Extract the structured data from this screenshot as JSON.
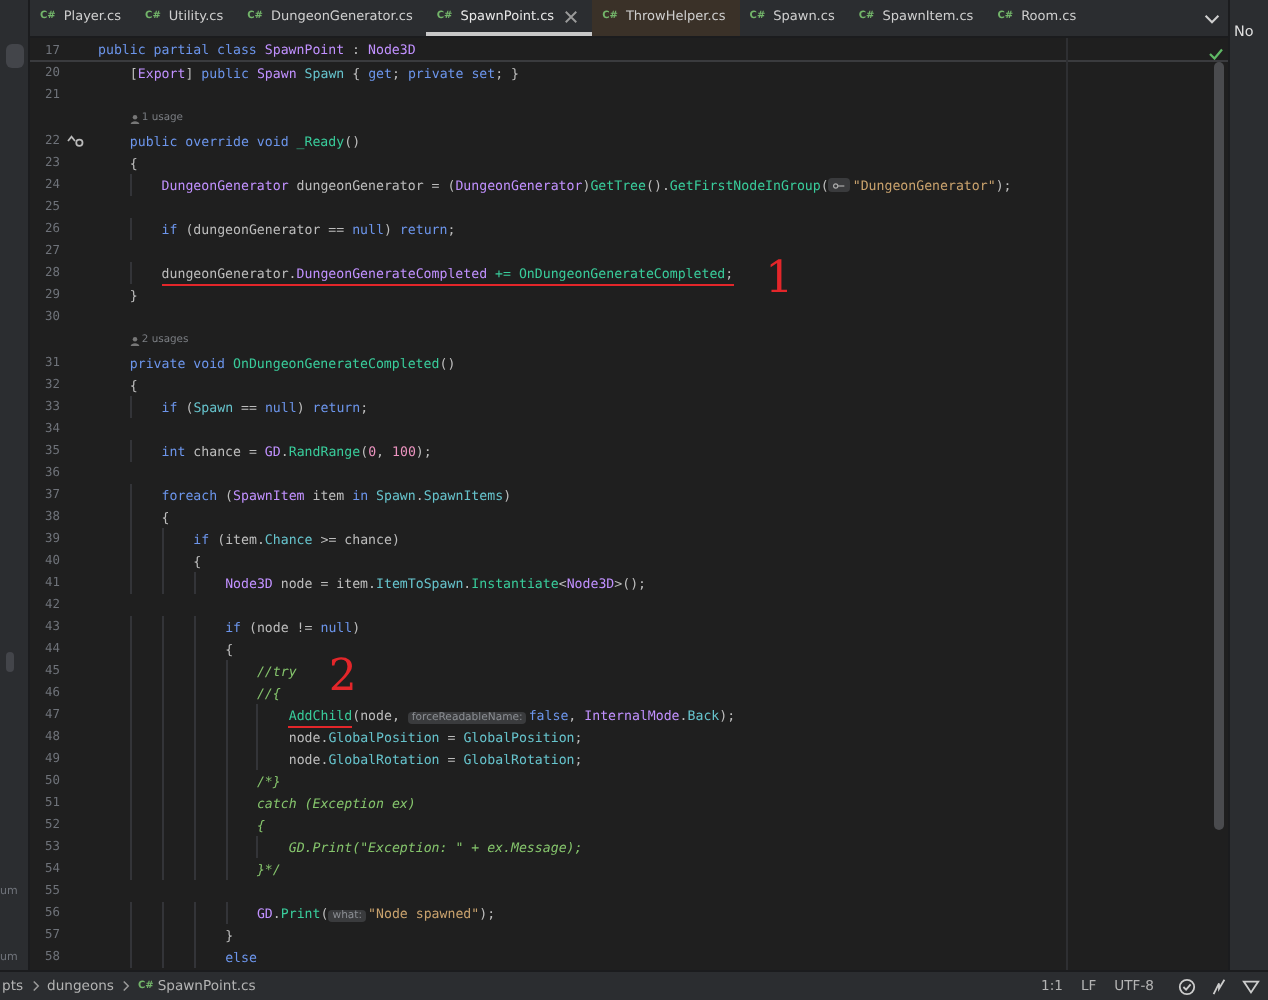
{
  "tabs": [
    {
      "type": "C#",
      "label": "Player.cs",
      "selected": false,
      "tinted": false
    },
    {
      "type": "C#",
      "label": "Utility.cs",
      "selected": false,
      "tinted": false
    },
    {
      "type": "C#",
      "label": "DungeonGenerator.cs",
      "selected": false,
      "tinted": false
    },
    {
      "type": "C#",
      "label": "SpawnPoint.cs",
      "selected": true,
      "tinted": false
    },
    {
      "type": "C#",
      "label": "ThrowHelper.cs",
      "selected": false,
      "tinted": true
    },
    {
      "type": "C#",
      "label": "Spawn.cs",
      "selected": false,
      "tinted": false
    },
    {
      "type": "C#",
      "label": "SpawnItem.cs",
      "selected": false,
      "tinted": false
    },
    {
      "type": "C#",
      "label": "Room.cs",
      "selected": false,
      "tinted": false
    }
  ],
  "right_panel": {
    "title": "No"
  },
  "lines": [
    {
      "number": "17",
      "sticky": true,
      "tokens": [
        {
          "kind": "kw",
          "text": "public partial class "
        },
        {
          "kind": "type",
          "text": "SpawnPoint"
        },
        {
          "kind": "p",
          "text": " : "
        },
        {
          "kind": "type",
          "text": "Node3D"
        }
      ]
    },
    {
      "number": "20",
      "tokens": [
        {
          "kind": "p",
          "text": "    ["
        },
        {
          "kind": "type",
          "text": "Export"
        },
        {
          "kind": "p",
          "text": "] "
        },
        {
          "kind": "kw",
          "text": "public "
        },
        {
          "kind": "type",
          "text": "Spawn "
        },
        {
          "kind": "field",
          "text": "Spawn"
        },
        {
          "kind": "p",
          "text": " { "
        },
        {
          "kind": "kw",
          "text": "get"
        },
        {
          "kind": "p",
          "text": "; "
        },
        {
          "kind": "kw",
          "text": "private set"
        },
        {
          "kind": "p",
          "text": "; }"
        }
      ]
    },
    {
      "number": "21"
    },
    {
      "number": "22",
      "usage": "1 usage",
      "marker": true,
      "tokens": [
        {
          "kind": "kw",
          "text": "    public override void "
        },
        {
          "kind": "method",
          "text": "_Ready"
        },
        {
          "kind": "p",
          "text": "()"
        }
      ]
    },
    {
      "number": "23",
      "tokens": [
        {
          "kind": "p",
          "text": "    {"
        }
      ]
    },
    {
      "number": "24",
      "tokens": [
        {
          "kind": "type",
          "text": "        DungeonGenerator"
        },
        {
          "kind": "p",
          "text": " dungeonGenerator = ("
        },
        {
          "kind": "type",
          "text": "DungeonGenerator"
        },
        {
          "kind": "p",
          "text": ")"
        },
        {
          "kind": "method",
          "text": "GetTree"
        },
        {
          "kind": "p",
          "text": "()."
        },
        {
          "kind": "method",
          "text": "GetFirstNodeInGroup"
        },
        {
          "kind": "p",
          "text": "("
        },
        {
          "kind": "hinticon"
        },
        {
          "kind": "str",
          "text": "\"DungeonGenerator\""
        },
        {
          "kind": "p",
          "text": ");"
        }
      ]
    },
    {
      "number": "25"
    },
    {
      "number": "26",
      "tokens": [
        {
          "kind": "kw",
          "text": "        if"
        },
        {
          "kind": "p",
          "text": " (dungeonGenerator == "
        },
        {
          "kind": "kw",
          "text": "null"
        },
        {
          "kind": "p",
          "text": ") "
        },
        {
          "kind": "kw",
          "text": "return"
        },
        {
          "kind": "p",
          "text": ";"
        }
      ]
    },
    {
      "number": "27"
    },
    {
      "number": "28",
      "annotation": "1",
      "tokens": [
        {
          "kind": "p",
          "text": "        dungeonGenerator.",
          "underlined": true
        },
        {
          "kind": "type",
          "text": "DungeonGenerateCompleted",
          "underlined": true
        },
        {
          "kind": "method",
          "text": " += OnDungeonGenerateCompleted",
          "underlined": true
        },
        {
          "kind": "p",
          "text": ";",
          "underlined": true
        }
      ]
    },
    {
      "number": "29",
      "tokens": [
        {
          "kind": "p",
          "text": "    }"
        }
      ]
    },
    {
      "number": "30"
    },
    {
      "number": "31",
      "usage": "2 usages",
      "tokens": [
        {
          "kind": "kw",
          "text": "    private void "
        },
        {
          "kind": "method",
          "text": "OnDungeonGenerateCompleted"
        },
        {
          "kind": "p",
          "text": "()"
        }
      ]
    },
    {
      "number": "32",
      "tokens": [
        {
          "kind": "p",
          "text": "    {"
        }
      ]
    },
    {
      "number": "33",
      "tokens": [
        {
          "kind": "kw",
          "text": "        if"
        },
        {
          "kind": "p",
          "text": " ("
        },
        {
          "kind": "field",
          "text": "Spawn"
        },
        {
          "kind": "p",
          "text": " == "
        },
        {
          "kind": "kw",
          "text": "null"
        },
        {
          "kind": "p",
          "text": ") "
        },
        {
          "kind": "kw",
          "text": "return"
        },
        {
          "kind": "p",
          "text": ";"
        }
      ]
    },
    {
      "number": "34"
    },
    {
      "number": "35",
      "tokens": [
        {
          "kind": "kw",
          "text": "        int"
        },
        {
          "kind": "p",
          "text": " chance = "
        },
        {
          "kind": "type",
          "text": "GD"
        },
        {
          "kind": "p",
          "text": "."
        },
        {
          "kind": "method",
          "text": "RandRange"
        },
        {
          "kind": "p",
          "text": "("
        },
        {
          "kind": "num",
          "text": "0"
        },
        {
          "kind": "p",
          "text": ", "
        },
        {
          "kind": "num",
          "text": "100"
        },
        {
          "kind": "p",
          "text": ");"
        }
      ]
    },
    {
      "number": "36"
    },
    {
      "number": "37",
      "tokens": [
        {
          "kind": "kw",
          "text": "        foreach"
        },
        {
          "kind": "p",
          "text": " ("
        },
        {
          "kind": "type",
          "text": "SpawnItem"
        },
        {
          "kind": "p",
          "text": " item "
        },
        {
          "kind": "kw",
          "text": "in "
        },
        {
          "kind": "field",
          "text": "Spawn"
        },
        {
          "kind": "p",
          "text": "."
        },
        {
          "kind": "field",
          "text": "SpawnItems"
        },
        {
          "kind": "p",
          "text": ")"
        }
      ]
    },
    {
      "number": "38",
      "tokens": [
        {
          "kind": "p",
          "text": "        {"
        }
      ]
    },
    {
      "number": "39",
      "tokens": [
        {
          "kind": "kw",
          "text": "            if"
        },
        {
          "kind": "p",
          "text": " (item."
        },
        {
          "kind": "field",
          "text": "Chance"
        },
        {
          "kind": "p",
          "text": " >= chance)"
        }
      ]
    },
    {
      "number": "40",
      "tokens": [
        {
          "kind": "p",
          "text": "            {"
        }
      ]
    },
    {
      "number": "41",
      "tokens": [
        {
          "kind": "type",
          "text": "                Node3D"
        },
        {
          "kind": "p",
          "text": " node = item."
        },
        {
          "kind": "field",
          "text": "ItemToSpawn"
        },
        {
          "kind": "p",
          "text": "."
        },
        {
          "kind": "method",
          "text": "Instantiate"
        },
        {
          "kind": "p",
          "text": "<"
        },
        {
          "kind": "type",
          "text": "Node3D"
        },
        {
          "kind": "p",
          "text": ">();"
        }
      ]
    },
    {
      "number": "42"
    },
    {
      "number": "43",
      "tokens": [
        {
          "kind": "kw",
          "text": "                if"
        },
        {
          "kind": "p",
          "text": " (node != "
        },
        {
          "kind": "kw",
          "text": "null"
        },
        {
          "kind": "p",
          "text": ")"
        }
      ]
    },
    {
      "number": "44",
      "tokens": [
        {
          "kind": "p",
          "text": "                {"
        }
      ]
    },
    {
      "number": "45",
      "annotation": "2",
      "tokens": [
        {
          "kind": "com",
          "text": "                    //try"
        }
      ]
    },
    {
      "number": "46",
      "tokens": [
        {
          "kind": "com",
          "text": "                    //{"
        }
      ]
    },
    {
      "number": "47",
      "tokens": [
        {
          "kind": "method",
          "text": "                        AddChild",
          "underlined": true
        },
        {
          "kind": "p",
          "text": "(node, "
        },
        {
          "kind": "hint",
          "text": "forceReadableName:"
        },
        {
          "kind": "kw",
          "text": "false"
        },
        {
          "kind": "p",
          "text": ", "
        },
        {
          "kind": "type",
          "text": "InternalMode"
        },
        {
          "kind": "p",
          "text": "."
        },
        {
          "kind": "field",
          "text": "Back"
        },
        {
          "kind": "p",
          "text": ");"
        }
      ]
    },
    {
      "number": "48",
      "tokens": [
        {
          "kind": "p",
          "text": "                        node."
        },
        {
          "kind": "field",
          "text": "GlobalPosition"
        },
        {
          "kind": "p",
          "text": " = "
        },
        {
          "kind": "field",
          "text": "GlobalPosition"
        },
        {
          "kind": "p",
          "text": ";"
        }
      ]
    },
    {
      "number": "49",
      "tokens": [
        {
          "kind": "p",
          "text": "                        node."
        },
        {
          "kind": "field",
          "text": "GlobalRotation"
        },
        {
          "kind": "p",
          "text": " = "
        },
        {
          "kind": "field",
          "text": "GlobalRotation"
        },
        {
          "kind": "p",
          "text": ";"
        }
      ]
    },
    {
      "number": "50",
      "tokens": [
        {
          "kind": "com",
          "text": "                    /*}"
        }
      ]
    },
    {
      "number": "51",
      "tokens": [
        {
          "kind": "com",
          "text": "                    catch (Exception ex)"
        }
      ]
    },
    {
      "number": "52",
      "tokens": [
        {
          "kind": "com",
          "text": "                    {"
        }
      ]
    },
    {
      "number": "53",
      "tokens": [
        {
          "kind": "com",
          "text": "                        GD.Print(\"Exception: \" + ex.Message);"
        }
      ]
    },
    {
      "number": "54",
      "tokens": [
        {
          "kind": "com",
          "text": "                    }*/"
        }
      ]
    },
    {
      "number": "55",
      "side_text": "um"
    },
    {
      "number": "56",
      "tokens": [
        {
          "kind": "type",
          "text": "                    GD"
        },
        {
          "kind": "p",
          "text": "."
        },
        {
          "kind": "method",
          "text": "Print"
        },
        {
          "kind": "p",
          "text": "("
        },
        {
          "kind": "hint",
          "text": "what:"
        },
        {
          "kind": "str",
          "text": "\"Node spawned\""
        },
        {
          "kind": "p",
          "text": ");"
        }
      ]
    },
    {
      "number": "57",
      "tokens": [
        {
          "kind": "p",
          "text": "                }"
        }
      ]
    },
    {
      "number": "58",
      "side_text": "um",
      "tokens": [
        {
          "kind": "kw",
          "text": "                else"
        }
      ]
    }
  ],
  "status_bar": {
    "breadcrumbs": [
      {
        "label": "pts"
      },
      {
        "label": "dungeons"
      },
      {
        "type": "C#",
        "label": "SpawnPoint.cs"
      }
    ],
    "position": "1:1",
    "line_ending": "LF",
    "encoding": "UTF-8"
  }
}
